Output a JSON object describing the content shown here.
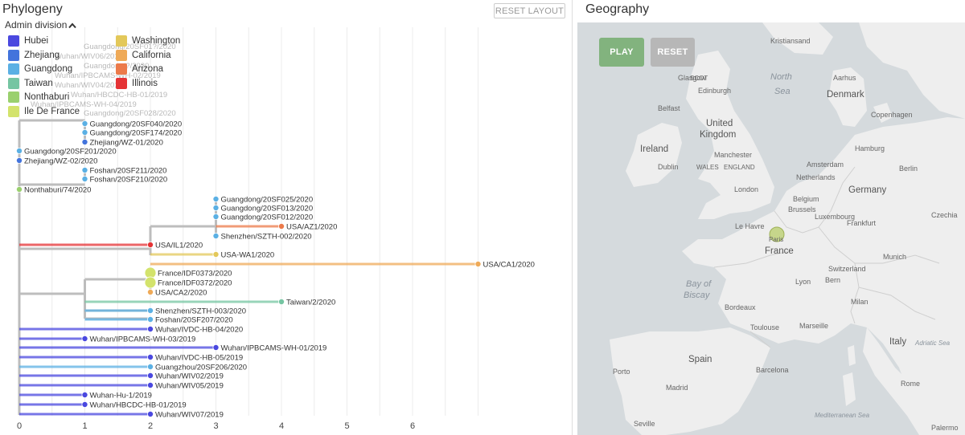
{
  "phylogeny": {
    "title": "Phylogeny",
    "reset_layout_label": "RESET LAYOUT",
    "color_by_label": "Admin division",
    "legend": [
      {
        "name": "Hubei",
        "color": "#4a48df"
      },
      {
        "name": "Zhejiang",
        "color": "#4374dc"
      },
      {
        "name": "Guangdong",
        "color": "#5bb0e4"
      },
      {
        "name": "Taiwan",
        "color": "#75c5a2"
      },
      {
        "name": "Nonthaburi",
        "color": "#9ad06e"
      },
      {
        "name": "Ile De France",
        "color": "#d3e36c"
      },
      {
        "name": "Washington",
        "color": "#e3c85a"
      },
      {
        "name": "California",
        "color": "#efaa58"
      },
      {
        "name": "Arizona",
        "color": "#ec7a4a"
      },
      {
        "name": "Illinois",
        "color": "#e53335"
      }
    ],
    "axis_ticks": [
      "0",
      "1",
      "2",
      "3",
      "4",
      "5",
      "6"
    ],
    "tips": [
      {
        "label": "Guangdong/20SF040/2020",
        "x": 1,
        "color": "#5bb0e4"
      },
      {
        "label": "Guangdong/20SF174/2020",
        "x": 1,
        "color": "#5bb0e4"
      },
      {
        "label": "Zhejiang/WZ-01/2020",
        "x": 1,
        "color": "#4374dc"
      },
      {
        "label": "Guangdong/20SF201/2020",
        "x": 0,
        "color": "#5bb0e4"
      },
      {
        "label": "Zhejiang/WZ-02/2020",
        "x": 0,
        "color": "#4374dc"
      },
      {
        "label": "Foshan/20SF211/2020",
        "x": 1,
        "color": "#5bb0e4"
      },
      {
        "label": "Foshan/20SF210/2020",
        "x": 1,
        "color": "#5bb0e4"
      },
      {
        "label": "Nonthaburi/74/2020",
        "x": 0,
        "color": "#9ad06e"
      },
      {
        "label": "Guangdong/20SF025/2020",
        "x": 3,
        "color": "#5bb0e4"
      },
      {
        "label": "Guangdong/20SF013/2020",
        "x": 3,
        "color": "#5bb0e4"
      },
      {
        "label": "Guangdong/20SF012/2020",
        "x": 3,
        "color": "#5bb0e4"
      },
      {
        "label": "USA/AZ1/2020",
        "x": 4,
        "color": "#ec7a4a"
      },
      {
        "label": "Shenzhen/SZTH-002/2020",
        "x": 3,
        "color": "#5bb0e4"
      },
      {
        "label": "USA/IL1/2020",
        "x": 2,
        "color": "#e53335"
      },
      {
        "label": "USA-WA1/2020",
        "x": 3,
        "color": "#e3c85a"
      },
      {
        "label": "USA/CA1/2020",
        "x": 7,
        "color": "#efaa58"
      },
      {
        "label": "France/IDF0373/2020",
        "x": 2,
        "color": "#d3e36c"
      },
      {
        "label": "France/IDF0372/2020",
        "x": 2,
        "color": "#d3e36c"
      },
      {
        "label": "USA/CA2/2020",
        "x": 2,
        "color": "#efaa58"
      },
      {
        "label": "Taiwan/2/2020",
        "x": 4,
        "color": "#75c5a2"
      },
      {
        "label": "Shenzhen/SZTH-003/2020",
        "x": 2,
        "color": "#5bb0e4"
      },
      {
        "label": "Foshan/20SF207/2020",
        "x": 2,
        "color": "#5bb0e4"
      },
      {
        "label": "Wuhan/IVDC-HB-04/2020",
        "x": 2,
        "color": "#4a48df"
      },
      {
        "label": "Wuhan/IPBCAMS-WH-03/2019",
        "x": 1,
        "color": "#4a48df"
      },
      {
        "label": "Wuhan/IPBCAMS-WH-01/2019",
        "x": 3,
        "color": "#4a48df"
      },
      {
        "label": "Wuhan/IVDC-HB-05/2019",
        "x": 2,
        "color": "#4a48df"
      },
      {
        "label": "Guangzhou/20SF206/2020",
        "x": 2,
        "color": "#5bb0e4"
      },
      {
        "label": "Wuhan/WIV02/2019",
        "x": 2,
        "color": "#4a48df"
      },
      {
        "label": "Wuhan/WIV05/2019",
        "x": 2,
        "color": "#4a48df"
      },
      {
        "label": "Wuhan-Hu-1/2019",
        "x": 1,
        "color": "#4a48df"
      },
      {
        "label": "Wuhan/HBCDC-HB-01/2019",
        "x": 1,
        "color": "#4a48df"
      },
      {
        "label": "Wuhan/WIV07/2019",
        "x": 2,
        "color": "#4a48df"
      }
    ],
    "faded_labels": [
      "Guangdong/20SF01?/2020",
      "Wuhan/WIV06/2019",
      "Guangdong/?/2020",
      "Wuhan/IPBCAMS-WH-02/2019",
      "Wuhan/WIV04/2019",
      "Wuhan/HBCDC-HB-01/2019",
      "Wuhan/IPBCAMS-WH-04/2019",
      "Guangdong/20SF028/2020"
    ]
  },
  "geography": {
    "title": "Geography",
    "play_label": "PLAY",
    "reset_label": "RESET",
    "seas": [
      "North",
      "Sea",
      "Bay of",
      "Biscay",
      "Adriatic Sea",
      "Mediterranean Sea"
    ],
    "countries": [
      "United",
      "Kingdom",
      "Ireland",
      "Denmark",
      "Netherlands",
      "Belgium",
      "Germany",
      "Luxembourg",
      "France",
      "Switzerland",
      "Spain",
      "Italy",
      "Czechia"
    ],
    "cities": [
      "Kristiansand",
      "Aarhus",
      "Copenhagen",
      "Glasgow",
      "Edinburgh",
      "SCOT",
      "Belfast",
      "Dublin",
      "Manchester",
      "ENGLAND",
      "WALES",
      "London",
      "Amsterdam",
      "Hamburg",
      "Berlin",
      "Brussels",
      "Frankfurt",
      "Le Havre",
      "Paris",
      "Lyon",
      "Bordeaux",
      "Toulouse",
      "Marseille",
      "Munich",
      "Bern",
      "Milan",
      "Rome",
      "Madrid",
      "Barcelona",
      "Porto",
      "Seville",
      "Palermo"
    ]
  }
}
